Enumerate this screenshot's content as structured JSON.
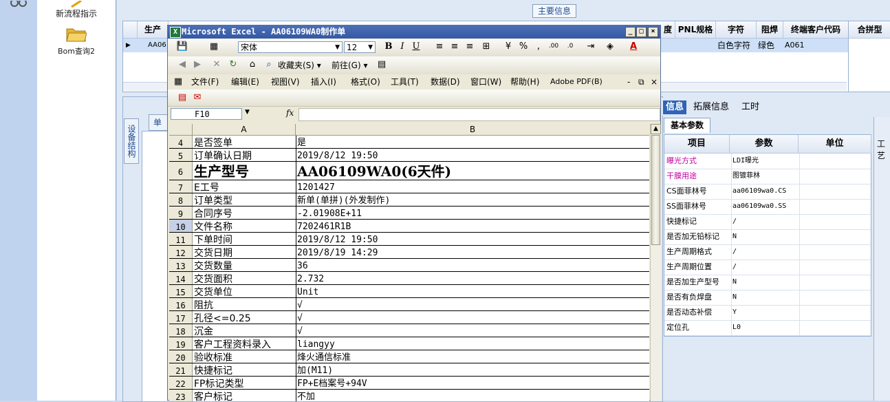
{
  "launcher": {
    "items": [
      {
        "label": "新流程指示",
        "icon": "new-flow-icon"
      },
      {
        "label": "Bom查询2",
        "icon": "folder-icon"
      }
    ]
  },
  "background_app": {
    "main_info_tab": "主要信息",
    "grid": {
      "headers_left": [
        "生产"
      ],
      "headers_right": [
        "度",
        "PNL规格",
        "字符",
        "阻焊",
        "终端客户代码",
        "合拼型"
      ],
      "row": {
        "left_code": "AA06",
        "char": "白色字符",
        "solder": "绿色",
        "customer": "A061"
      }
    },
    "vertical_tab": "设备结构",
    "single_tab": "单",
    "info_tabs": [
      "信息",
      "拓展信息",
      "工时"
    ],
    "basic_tab": "基本参数",
    "param_headers": [
      "项目",
      "参数",
      "单位"
    ],
    "params": [
      {
        "name": "曝光方式",
        "value": "LDI曝光",
        "highlight": true
      },
      {
        "name": "干膜用途",
        "value": "图镀菲林",
        "highlight": true
      },
      {
        "name": "CS面菲林号",
        "value": "aa06109wa0.CS",
        "highlight": false
      },
      {
        "name": "SS面菲林号",
        "value": "aa06109wa0.SS",
        "highlight": false
      },
      {
        "name": "快捷标记",
        "value": "/",
        "highlight": false
      },
      {
        "name": "是否加无铅标记",
        "value": "N",
        "highlight": false
      },
      {
        "name": "生产周期格式",
        "value": "/",
        "highlight": false
      },
      {
        "name": "生产周期位置",
        "value": "/",
        "highlight": false
      },
      {
        "name": "是否加生产型号",
        "value": "N",
        "highlight": false
      },
      {
        "name": "是否有负焊盘",
        "value": "N",
        "highlight": false
      },
      {
        "name": "是否动态补偿",
        "value": "Y",
        "highlight": false
      },
      {
        "name": "定位孔",
        "value": "L0",
        "highlight": false
      }
    ],
    "right_edge_label": "工艺"
  },
  "excel": {
    "title": "Microsoft Excel - AA06109WA0制作单",
    "font_name": "宋体",
    "font_size": "12",
    "favorites": "收藏夹(S)",
    "goto": "前往(G)",
    "menus": [
      "文件(F)",
      "编辑(E)",
      "视图(V)",
      "插入(I)",
      "格式(O)",
      "工具(T)",
      "数据(D)",
      "窗口(W)",
      "帮助(H)",
      "Adobe PDF(B)"
    ],
    "name_box": "F10",
    "fx": "fx",
    "columns": [
      "A",
      "B"
    ],
    "rows": [
      {
        "n": "4",
        "a": "是否签单",
        "b": "是"
      },
      {
        "n": "5",
        "a": "订单确认日期",
        "b": "2019/8/12 19:50"
      },
      {
        "n": "6",
        "a": "生产型号",
        "b": "AA06109WA0(6天件)"
      },
      {
        "n": "7",
        "a": "E工号",
        "b": "1201427"
      },
      {
        "n": "8",
        "a": "订单类型",
        "b": "新单(单拼)(外发制作)"
      },
      {
        "n": "9",
        "a": "合同序号",
        "b": "-2.01908E+11"
      },
      {
        "n": "10",
        "a": "文件名称",
        "b": "7202461R1B"
      },
      {
        "n": "11",
        "a": "下单时间",
        "b": "2019/8/12 19:50"
      },
      {
        "n": "12",
        "a": "交货日期",
        "b": "2019/8/19 14:29"
      },
      {
        "n": "13",
        "a": "交货数量",
        "b": "36"
      },
      {
        "n": "14",
        "a": "交货面积",
        "b": "2.732"
      },
      {
        "n": "15",
        "a": "交货单位",
        "b": "Unit"
      },
      {
        "n": "16",
        "a": "阻抗",
        "b": "√"
      },
      {
        "n": "17",
        "a": "孔径<=0.25",
        "b": "√"
      },
      {
        "n": "18",
        "a": "沉金",
        "b": "√"
      },
      {
        "n": "19",
        "a": "客户工程资料录入",
        "b": "liangyy"
      },
      {
        "n": "20",
        "a": "验收标准",
        "b": "烽火通信标准"
      },
      {
        "n": "21",
        "a": "快捷标记",
        "b": "加(M11)"
      },
      {
        "n": "22",
        "a": "FP标记类型",
        "b": "FP+E档案号+94V"
      },
      {
        "n": "23",
        "a": "客户标记",
        "b": "不加"
      }
    ]
  },
  "colors": {
    "accent": "#3558a4",
    "highlight_text": "#c000a0",
    "selection": "#cde0f7"
  }
}
